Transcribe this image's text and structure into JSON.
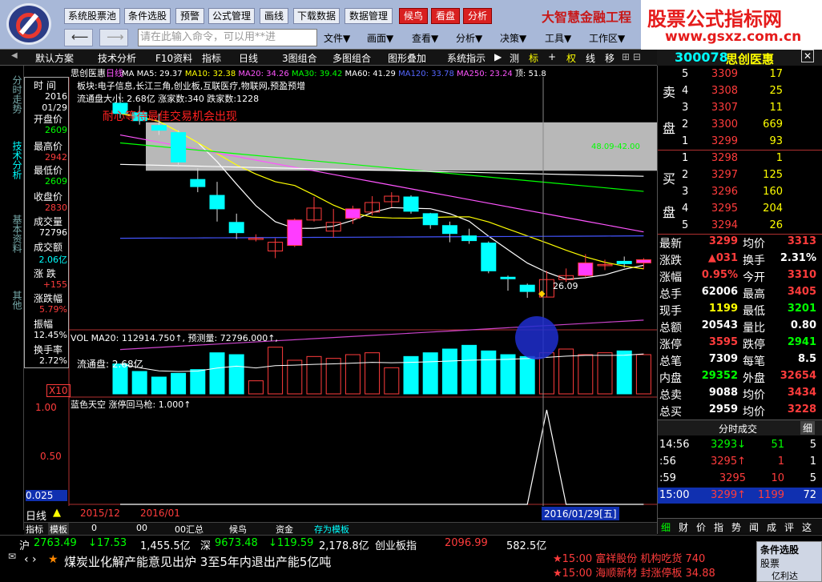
{
  "toolbar": {
    "buttons": [
      "系统股票池",
      "条件选股",
      "预警",
      "公式管理",
      "画线",
      "下载数据",
      "数据管理"
    ],
    "red_buttons": [
      "候鸟",
      "看盘",
      "分析"
    ],
    "brand": "大智慧金融工程",
    "command_placeholder": "请在此输入命令，可以用**进",
    "menus": [
      "文件▼",
      "画面▼",
      "查看▼",
      "分析▼",
      "决策▼",
      "工具▼",
      "工作区▼"
    ]
  },
  "watermark": {
    "title": "股票公式指标网",
    "url": "www.gsxz.com.cn"
  },
  "tabs": [
    "默认方案",
    "技术分析",
    "F10资料",
    "指标",
    "日线",
    "3图组合",
    "多图组合",
    "图形叠加",
    "系统指示",
    "测",
    "标",
    "+",
    "权",
    "线",
    "移"
  ],
  "stock": {
    "code": "300078",
    "name": "思创医惠"
  },
  "side_tabs": [
    "分时走势",
    "技术分析",
    "基本资料",
    "其他"
  ],
  "info_panel": {
    "rows": [
      {
        "label": "时 间",
        "value": "2016",
        "value2": "01/29",
        "color": "#ffffff"
      },
      {
        "label": "开盘价",
        "value": "2609",
        "color": "#00ff00"
      },
      {
        "label": "最高价",
        "value": "2942",
        "color": "#ff3c3c"
      },
      {
        "label": "最低价",
        "value": "2609",
        "color": "#00ff00"
      },
      {
        "label": "收盘价",
        "value": "2830",
        "color": "#ff3c3c"
      },
      {
        "label": "成交量",
        "value": "72796",
        "color": "#ffffff"
      },
      {
        "label": "成交额",
        "value": "2.06亿",
        "color": "#00ffff"
      },
      {
        "label": "涨 跌",
        "value": "+155",
        "color": "#ff3c3c"
      },
      {
        "label": "涨跌幅",
        "value": "5.79%",
        "color": "#ff3c3c"
      },
      {
        "label": "振幅",
        "value": "12.45%",
        "color": "#ffffff"
      },
      {
        "label": "换手率",
        "value": "2.72%",
        "color": "#ffffff"
      }
    ]
  },
  "chart": {
    "title": "思创医惠",
    "period": "日线",
    "ma_line": "MA  MA5: 29.37↓  MA10: 32.38↓  MA20: 34.26↓  MA30: 39.42↓  MA60: 41.29↓  MA120: 33.78↑  MA250: 23.24↑  顶: 51.8",
    "ma_labels": [
      {
        "text": "MA  MA5: 29.37",
        "color": "#ffffff"
      },
      {
        "text": "MA10: 32.38",
        "color": "#ffff00"
      },
      {
        "text": "MA20: 34.26",
        "color": "#ff55ff"
      },
      {
        "text": "MA30: 39.42",
        "color": "#00ff00"
      },
      {
        "text": "MA60: 41.29",
        "color": "#ffffff"
      },
      {
        "text": "MA120: 33.78",
        "color": "#5566ff"
      },
      {
        "text": "MA250: 23.24",
        "color": "#ff55ff"
      },
      {
        "text": "顶: 51.8",
        "color": "#ffffff"
      }
    ],
    "sector": "板块:电子信息,长江三角,创业板,互联医疗,物联网,预盈预增",
    "float_line": "流通盘大小: 2.68亿   涨家数:340   跌家数:1228",
    "slogan": "耐心等待最佳交易机会出现",
    "band_label": "48.09-42.00",
    "low_label": "26.09",
    "vol_label": "VOL  MA20: 112914.750↑, 预测量: 72796.000↑,",
    "float_cap": "流通盘: 2.68亿",
    "vol_scale": "X10",
    "ind_label": "蓝色天空  涨停回马枪: 1.000↑",
    "ind_ticks": [
      "1.00",
      "0.50",
      "0.025"
    ],
    "dates": [
      "2015/12",
      "2016/01",
      "2016/01/29[五]"
    ],
    "period_label": "日线"
  },
  "chart_data": {
    "type": "candlestick",
    "title": "思创医惠 日线",
    "candles": [
      {
        "o": 50.5,
        "h": 51.8,
        "l": 48.6,
        "c": 49.2
      },
      {
        "o": 49.3,
        "h": 50.2,
        "l": 47.8,
        "c": 48.3
      },
      {
        "o": 47.7,
        "h": 49.2,
        "l": 46.5,
        "c": 47.1
      },
      {
        "o": 46.8,
        "h": 47.1,
        "l": 42.5,
        "c": 43.1
      },
      {
        "o": 40.9,
        "h": 42.3,
        "l": 39.3,
        "c": 40.0
      },
      {
        "o": 38.9,
        "h": 40.6,
        "l": 35.6,
        "c": 37.2
      },
      {
        "o": 35.5,
        "h": 36.6,
        "l": 33.4,
        "c": 34.2
      },
      {
        "o": 33.4,
        "h": 34.0,
        "l": 33.1,
        "c": 33.5
      },
      {
        "o": 31.9,
        "h": 33.5,
        "l": 31.0,
        "c": 33.0
      },
      {
        "o": 32.6,
        "h": 36.0,
        "l": 32.4,
        "c": 35.8
      },
      {
        "o": 35.8,
        "h": 38.7,
        "l": 35.6,
        "c": 37.3
      },
      {
        "o": 34.4,
        "h": 37.2,
        "l": 33.6,
        "c": 35.5
      },
      {
        "o": 36.0,
        "h": 37.6,
        "l": 35.3,
        "c": 37.2
      },
      {
        "o": 36.8,
        "h": 38.8,
        "l": 36.4,
        "c": 38.0
      },
      {
        "o": 38.1,
        "h": 39.3,
        "l": 37.4,
        "c": 38.8
      },
      {
        "o": 38.7,
        "h": 38.9,
        "l": 36.6,
        "c": 36.9
      },
      {
        "o": 36.6,
        "h": 36.7,
        "l": 34.7,
        "c": 35.2
      },
      {
        "o": 35.1,
        "h": 35.6,
        "l": 33.0,
        "c": 34.1
      },
      {
        "o": 33.8,
        "h": 34.7,
        "l": 32.8,
        "c": 33.2
      },
      {
        "o": 32.9,
        "h": 33.1,
        "l": 29.1,
        "c": 29.4
      },
      {
        "o": 28.6,
        "h": 28.8,
        "l": 26.9,
        "c": 28.4
      },
      {
        "o": 27.6,
        "h": 27.8,
        "l": 26.0,
        "c": 26.8
      },
      {
        "o": 26.1,
        "h": 29.4,
        "l": 26.1,
        "c": 28.3
      },
      {
        "o": 28.3,
        "h": 29.7,
        "l": 28.0,
        "c": 28.8
      },
      {
        "o": 28.8,
        "h": 31.5,
        "l": 28.6,
        "c": 30.4
      },
      {
        "o": 30.1,
        "h": 30.8,
        "l": 29.5,
        "c": 30.2
      },
      {
        "o": 30.6,
        "h": 31.2,
        "l": 29.8,
        "c": 30.3
      },
      {
        "o": 30.4,
        "h": 31.0,
        "l": 29.6,
        "c": 30.8
      }
    ],
    "volume": [
      16,
      12,
      9,
      11,
      13,
      22,
      21,
      7,
      25,
      18,
      20,
      19,
      21,
      22,
      14,
      20,
      22,
      24,
      26,
      23,
      21,
      20,
      22,
      24,
      21,
      22,
      23,
      21
    ],
    "indicator": [
      0,
      0,
      0,
      0,
      0,
      0,
      0,
      0,
      0,
      0,
      0,
      0,
      0,
      0,
      0,
      0,
      0,
      0,
      0,
      0,
      0,
      0,
      1,
      0,
      0,
      0,
      0,
      0
    ],
    "ylim": [
      25,
      52
    ]
  },
  "orderbook": {
    "sell_label": [
      "卖",
      "盘"
    ],
    "buy_label": [
      "买",
      "盘"
    ],
    "sells": [
      {
        "lv": "5",
        "price": "3309",
        "vol": "17"
      },
      {
        "lv": "4",
        "price": "3308",
        "vol": "25"
      },
      {
        "lv": "3",
        "price": "3307",
        "vol": "11"
      },
      {
        "lv": "2",
        "price": "3300",
        "vol": "669"
      },
      {
        "lv": "1",
        "price": "3299",
        "vol": "93"
      }
    ],
    "buys": [
      {
        "lv": "1",
        "price": "3298",
        "vol": "1"
      },
      {
        "lv": "2",
        "price": "3297",
        "vol": "125"
      },
      {
        "lv": "3",
        "price": "3296",
        "vol": "160"
      },
      {
        "lv": "4",
        "price": "3295",
        "vol": "204"
      },
      {
        "lv": "5",
        "price": "3294",
        "vol": "26"
      }
    ]
  },
  "quote": [
    {
      "k": "最新",
      "v": "3299",
      "vc": "#ff3c3c",
      "k2": "均价",
      "v2": "3313",
      "v2c": "#ff3c3c"
    },
    {
      "k": "涨跌",
      "v": "▲031",
      "vc": "#ff3c3c",
      "k2": "换手",
      "v2": "2.31%",
      "v2c": "#ffffff"
    },
    {
      "k": "涨幅",
      "v": "0.95%",
      "vc": "#ff3c3c",
      "k2": "今开",
      "v2": "3310",
      "v2c": "#ff3c3c"
    },
    {
      "k": "总手",
      "v": "62006",
      "vc": "#ffffff",
      "k2": "最高",
      "v2": "3405",
      "v2c": "#ff3c3c"
    },
    {
      "k": "现手",
      "v": "1199",
      "vc": "#ffff00",
      "k2": "最低",
      "v2": "3201",
      "v2c": "#00ff00"
    },
    {
      "k": "总额",
      "v": "20543",
      "vc": "#ffffff",
      "k2": "量比",
      "v2": "0.80",
      "v2c": "#ffffff"
    },
    {
      "k": "涨停",
      "v": "3595",
      "vc": "#ff3c3c",
      "k2": "跌停",
      "v2": "2941",
      "v2c": "#00ff00"
    },
    {
      "k": "总笔",
      "v": "7309",
      "vc": "#ffffff",
      "k2": "每笔",
      "v2": "8.5",
      "v2c": "#ffffff"
    },
    {
      "k": "内盘",
      "v": "29352",
      "vc": "#00ff00",
      "k2": "外盘",
      "v2": "32654",
      "v2c": "#ff3c3c"
    },
    {
      "k": "总卖",
      "v": "9088",
      "vc": "#ffffff",
      "k2": "均价",
      "v2": "3434",
      "v2c": "#ff3c3c"
    },
    {
      "k": "总买",
      "v": "2959",
      "vc": "#ffffff",
      "k2": "均价",
      "v2": "3228",
      "v2c": "#ff3c3c"
    }
  ],
  "ticks": {
    "title": "分时成交",
    "detail": "细",
    "rows": [
      {
        "t": "14:56",
        "p": "3293↓",
        "pc": "#00ff00",
        "v": "51",
        "vc": "#00ff00",
        "n": "5"
      },
      {
        "t": ":56",
        "p": "3295↑",
        "pc": "#ff3c3c",
        "v": "1",
        "vc": "#ff3c3c",
        "n": "1"
      },
      {
        "t": ":59",
        "p": "3295",
        "pc": "#ff3c3c",
        "v": "10",
        "vc": "#ff3c3c",
        "n": "5"
      },
      {
        "t": "15:00",
        "p": "3299↑",
        "pc": "#ff3c3c",
        "v": "1199",
        "vc": "#ff3c3c",
        "n": "72"
      }
    ]
  },
  "right_tabs": [
    "细",
    "财",
    "价",
    "指",
    "势",
    "闻",
    "成",
    "评",
    "这"
  ],
  "bottom_tabs": [
    "指标",
    "模板",
    "0",
    "00",
    "00汇总",
    "候鸟",
    "资金",
    "存为模板"
  ],
  "ticker": {
    "sh_label": "沪",
    "sh": "2763.49",
    "sh_chg": "↓17.53",
    "sh_amt": "1,455.5亿",
    "sz_label": "深",
    "sz": "9673.48",
    "sz_chg": "↓119.59",
    "sz_amt": "2,178.8亿",
    "cy_label": "创业板指",
    "cy": "2096.99",
    "cy_amt": "582.5亿"
  },
  "news": {
    "headline": "煤炭业化解产能意见出炉 3至5年内退出产能5亿吨",
    "alert1": "★15:00 富祥股份 机构吃货 740",
    "alert2": "★15:00 海顺新材 封涨停板 34.88",
    "panel_title": "条件选股",
    "panel_item": "股票",
    "panel_item2": "亿利达"
  }
}
